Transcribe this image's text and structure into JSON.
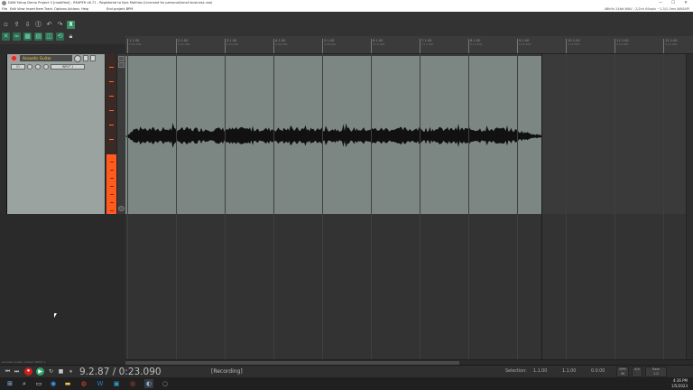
{
  "window": {
    "title": "DAW Setup Demo Project 3 [modified] - REAPER v6.71 - Registered to Kyle Mathias (Licensed for personal/small business use)",
    "controls": [
      "—",
      "☐",
      "✕"
    ]
  },
  "menu": {
    "items": [
      "File",
      "Edit",
      "View",
      "Insert",
      "Item",
      "Track",
      "Options",
      "Actions",
      "Help",
      "End project BPM"
    ],
    "status": "48kHz 24bit WAV : 2/2ch 64spls ~1.3/1.3ms WASAPI"
  },
  "ruler": {
    "marks": [
      {
        "bar": "1.1.00",
        "time": "0:00.000"
      },
      {
        "bar": "2.1.00",
        "time": "0:02.000"
      },
      {
        "bar": "3.1.00",
        "time": "0:04.000"
      },
      {
        "bar": "4.1.00",
        "time": "0:06.000"
      },
      {
        "bar": "5.1.00",
        "time": "0:08.000"
      },
      {
        "bar": "6.1.00",
        "time": "0:10.000"
      },
      {
        "bar": "7.1.00",
        "time": "0:12.000"
      },
      {
        "bar": "8.1.00",
        "time": "0:14.000"
      },
      {
        "bar": "9.1.00",
        "time": "0:16.000"
      },
      {
        "bar": "10.1.00",
        "time": "0:18.000"
      },
      {
        "bar": "11.1.00",
        "time": "0:20.000"
      },
      {
        "bar": "12.1.00",
        "time": "0:22.000"
      }
    ]
  },
  "track": {
    "name": "Acoustic Guitar",
    "io_label": "IO",
    "input_label": "INPUT 1",
    "route_label": "R"
  },
  "transport": {
    "timecode": "9.2.87 / 0:23.090",
    "state": "[Recording]",
    "selection_label": "Selection:",
    "selection_start": "1.1.00",
    "selection_end": "1.1.00",
    "selection_length": "0.0.00",
    "bpm_label": "BPM",
    "bpm_value": "96",
    "sig_label": "4/4",
    "rate_label": "Rate",
    "rate_value": "1.0"
  },
  "leftnote": "Acoustic Guitar: Armed: INPUT 1",
  "taskbar": {
    "time": "4:36 PM",
    "date": "1/5/2023"
  },
  "colors": {
    "item": "#7c8784",
    "meter": "#ff5a1f",
    "record": "#d11f1f",
    "play": "#2fa86a",
    "track_name": "#ffcc33"
  }
}
